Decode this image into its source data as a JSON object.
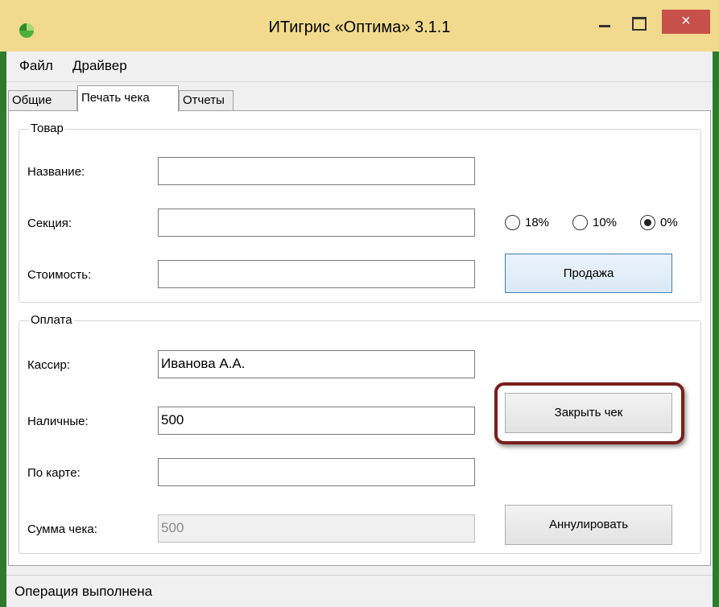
{
  "window": {
    "title": "ИТигрис «Оптима» 3.1.1",
    "close_label": "×"
  },
  "menu": {
    "items": [
      "Файл",
      "Драйвер"
    ]
  },
  "tabs": [
    "Общие",
    "Печать чека",
    "Отчеты"
  ],
  "active_tab": "Печать чека",
  "product": {
    "group_title": "Товар",
    "name_label": "Название:",
    "name_value": "",
    "section_label": "Секция:",
    "section_value": "",
    "cost_label": "Стоимость:",
    "cost_value": "",
    "vat_options": [
      "18%",
      "10%",
      "0%"
    ],
    "vat_selected": "0%",
    "sale_button": "Продажа"
  },
  "payment": {
    "group_title": "Оплата",
    "cashier_label": "Кассир:",
    "cashier_value": "Иванова А.А.",
    "cash_label": "Наличные:",
    "cash_value": "500",
    "card_label": "По карте:",
    "card_value": "",
    "total_label": "Сумма чека:",
    "total_value": "500",
    "close_receipt_button": "Закрыть чек",
    "cancel_button": "Аннулировать"
  },
  "status": {
    "text": "Операция выполнена"
  },
  "colors": {
    "close_button": "#c7504b",
    "highlight_frame": "#7a1e1c",
    "focus_border": "#3c7fb1"
  }
}
